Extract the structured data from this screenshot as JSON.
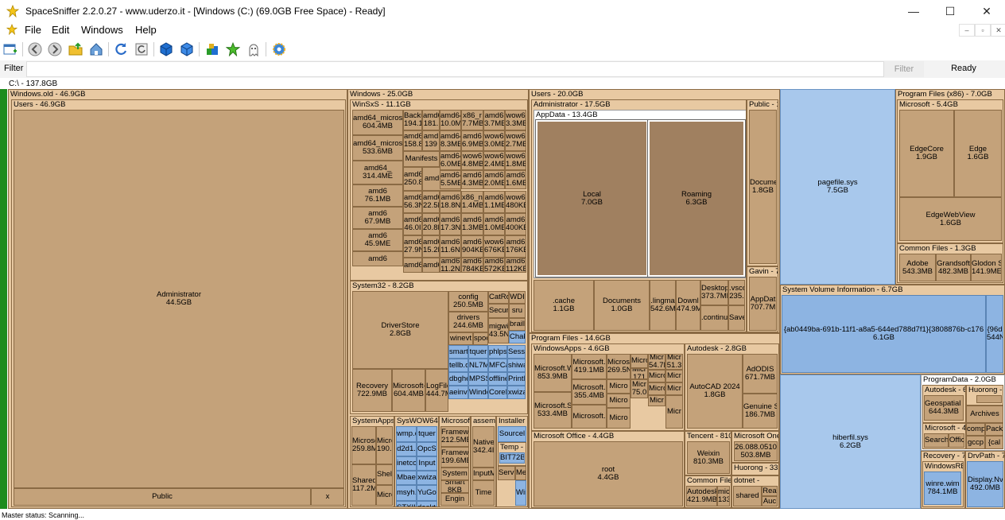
{
  "window": {
    "title": "SpaceSniffer 2.2.0.27 - www.uderzo.it - [Windows (C:) (69.0GB Free Space) - Ready]",
    "minimize": "—",
    "maximize": "☐",
    "close": "✕"
  },
  "menu": {
    "items": [
      "File",
      "Edit",
      "Windows",
      "Help"
    ],
    "mdi": [
      "–",
      "▫",
      "✕"
    ]
  },
  "toolbar": {
    "icons": [
      "new-window-icon",
      "back-icon",
      "forward-icon",
      "folder-up-icon",
      "home-icon",
      "refresh-icon",
      "rescan-icon",
      "blue-cube-icon",
      "blue-cube-2-icon",
      "tag-icon",
      "star-icon",
      "ghost-icon",
      "settings-gear-icon"
    ]
  },
  "filter": {
    "label": "Filter",
    "value": "",
    "button": "Filter",
    "status": "Ready"
  },
  "breadcrumb": "C:\\ - 137.8GB",
  "status_text": "Master status: Scanning...",
  "treemap": {
    "windows_old": {
      "header": "Windows.old - 46.9GB",
      "users_header": "Users - 46.9GB",
      "administrator": {
        "name": "Administrator",
        "size": "44.5GB"
      },
      "public": {
        "name": "Public"
      },
      "x": {
        "name": "x"
      }
    },
    "windows": {
      "header": "Windows - 25.0GB",
      "winsxs": {
        "header": "WinSxS - 11.1GB",
        "cells": [
          {
            "name": "amd64_micros",
            "size": "604.4MB"
          },
          {
            "name": "amd64_micros",
            "size": "533.6MB"
          },
          {
            "name": "amd64_",
            "size": "314.4ME"
          },
          {
            "name": "amd6",
            "size": "76.1MB"
          },
          {
            "name": "amd6",
            "size": "67.9MB"
          },
          {
            "name": "amd6",
            "size": "45.9ME"
          },
          {
            "name": "amd6",
            "size": ""
          },
          {
            "name": "Backu",
            "size": "194.1"
          },
          {
            "name": "amd6",
            "size": "158.8"
          },
          {
            "name": "Manifests",
            "size": ""
          },
          {
            "name": "amd64_",
            "size": "250.8I"
          },
          {
            "name": "amd64_wi",
            "size": ""
          },
          {
            "name": "amd6",
            "size": "56.3N"
          },
          {
            "name": "amd6",
            "size": "46.0I"
          },
          {
            "name": "amd6",
            "size": "27.9N"
          },
          {
            "name": "amd6",
            "size": ""
          },
          {
            "name": "amd64",
            "size": "22.5M"
          },
          {
            "name": "amd64",
            "size": "20.8M"
          },
          {
            "name": "amd64",
            "size": "15.2M"
          },
          {
            "name": "amd64",
            "size": ""
          },
          {
            "name": "amd6",
            "size": "181."
          },
          {
            "name": "amd",
            "size": "139"
          },
          {
            "name": "amd6",
            "size": "18.8N"
          },
          {
            "name": "amd6",
            "size": "17.3N"
          },
          {
            "name": "amd6",
            "size": "11.6N"
          },
          {
            "name": "amd6",
            "size": "11.2N"
          },
          {
            "name": "amd64",
            "size": "10.0M"
          },
          {
            "name": "amd64",
            "size": "8.3MB"
          },
          {
            "name": "amd64",
            "size": "6.0MB"
          },
          {
            "name": "amd64",
            "size": "5.5MB"
          },
          {
            "name": "x86_n",
            "size": "1.4MB"
          },
          {
            "name": "amd6",
            "size": "1.3MB"
          },
          {
            "name": "amd6",
            "size": "904KB"
          },
          {
            "name": "amd6",
            "size": "784KB"
          },
          {
            "name": "x86_r",
            "size": "7.7MB"
          },
          {
            "name": "amd6",
            "size": "6.9MB"
          },
          {
            "name": "wow6",
            "size": "4.8MB"
          },
          {
            "name": "amd6",
            "size": "4.3MB"
          },
          {
            "name": "amd6",
            "size": "1.1MB"
          },
          {
            "name": "amd6",
            "size": "1.0MB"
          },
          {
            "name": "wow6",
            "size": "676KB"
          },
          {
            "name": "amd6",
            "size": "572KE"
          },
          {
            "name": "amd6",
            "size": "3.7MB"
          },
          {
            "name": "wow6",
            "size": "3.0MB"
          },
          {
            "name": "wow6",
            "size": "2.4MB"
          },
          {
            "name": "amd6",
            "size": "2.0MB"
          },
          {
            "name": "wow6",
            "size": "480KE"
          },
          {
            "name": "amd6",
            "size": "400KE"
          },
          {
            "name": "amd6",
            "size": "176KE"
          },
          {
            "name": "amd6",
            "size": "112KE"
          },
          {
            "name": "wow6",
            "size": "3.3MB"
          },
          {
            "name": "wow6",
            "size": "2.7MB"
          },
          {
            "name": "wow6",
            "size": "1.8MB"
          },
          {
            "name": "amd6",
            "size": "1.6MB"
          },
          {
            "name": "wow6",
            "size": "320KE"
          },
          {
            "name": "amd6",
            "size": "244KE"
          },
          {
            "name": "amd6",
            "size": "60KB"
          },
          {
            "name": "x86_v",
            "size": "4KB"
          }
        ]
      },
      "system32": {
        "header": "System32 - 8.2GB",
        "driverstore": {
          "name": "DriverStore",
          "size": "2.8GB"
        },
        "recovery": {
          "name": "Recovery",
          "size": "722.9MB"
        },
        "microsoft": {
          "name": "Microsoft-",
          "size": "604.4MB"
        },
        "logfiles": {
          "name": "LogFile",
          "size": "444.7M"
        },
        "config": {
          "name": "config",
          "size": "250.5MB"
        },
        "drivers": {
          "name": "drivers",
          "size": "244.6MB"
        },
        "catroot": {
          "name": "CatRo"
        },
        "wdi": {
          "name": "WDI"
        },
        "secur": {
          "name": "Secur"
        },
        "sru": {
          "name": "sru"
        },
        "migwiz": {
          "name": "migwi",
          "size": "43.5N"
        },
        "brailler": {
          "name": "braill"
        },
        "winevt": {
          "name": "winevt"
        },
        "spool": {
          "name": "spoo"
        },
        "chakra": {
          "name": "Chak"
        },
        "smart": {
          "name": "smart"
        },
        "tquer": {
          "name": "tquer"
        },
        "phlps": {
          "name": "phlps"
        },
        "sesse": {
          "name": "SessE"
        },
        "tellib": {
          "name": "tellb.c"
        },
        "nl7m": {
          "name": "NL7M"
        },
        "mfca": {
          "name": "MFCa"
        },
        "shiwa": {
          "name": "shiwa"
        },
        "dbghe": {
          "name": "dbghe"
        },
        "mpss": {
          "name": "MPSS"
        },
        "offline": {
          "name": "offline"
        },
        "printb": {
          "name": "PrintI"
        },
        "aeinv": {
          "name": "aeinv."
        },
        "windo": {
          "name": "Windo"
        },
        "corefx": {
          "name": "CoreF"
        },
        "xwiza": {
          "name": "xwiza"
        }
      },
      "systemapps": {
        "header": "SystemApps",
        "microsoft": {
          "name": "Microso",
          "size": "259.8M"
        },
        "micro2": {
          "name": "Micro",
          "size": "190.2"
        },
        "shared": {
          "name": "Shared",
          "size": "117.2M"
        },
        "shell": {
          "name": "Shell"
        },
        "micro3": {
          "name": "Micro"
        }
      },
      "syswow64": {
        "header": "SysWOW64",
        "cells": [
          "wmp.d",
          "tquer",
          "d2d1.",
          "OpcSe",
          "inetco",
          "Input",
          "Mbae",
          "xwiza",
          "msyh.",
          "YuGot",
          "STXIHi",
          "deskto"
        ]
      },
      "microsoft_net": {
        "header": "Microsoft.",
        "framework1": {
          "name": "Framewo",
          "size": "212.5ME"
        },
        "framework2": {
          "name": "Framewo",
          "size": "199.6ME"
        },
        "system": {
          "name": "System"
        },
        "smart": {
          "name": "Smart",
          "size": "8KB"
        },
        "engin": {
          "name": "Engin"
        }
      },
      "assembly": {
        "header": "assemb",
        "native": {
          "name": "Native",
          "size": "342.4I"
        },
        "input": {
          "name": "InputM"
        },
        "time": {
          "name": "Time"
        }
      },
      "installer": {
        "header": "Installer -",
        "source": {
          "name": "Sourcel"
        },
        "temp": {
          "name": "Temp - 2"
        },
        "bit72": {
          "name": "BIT72B."
        },
        "servic": {
          "name": "Servic"
        },
        "media": {
          "name": "Media"
        },
        "windo": {
          "name": "Windo"
        }
      }
    },
    "users": {
      "header": "Users - 20.0GB",
      "administrator": {
        "header": "Administrator - 17.5GB",
        "appdata": {
          "header": "AppData - 13.4GB",
          "local": {
            "name": "Local",
            "size": "7.0GB"
          },
          "roaming": {
            "name": "Roaming",
            "size": "6.3GB"
          }
        },
        "cache": {
          "name": ".cache",
          "size": "1.1GB"
        },
        "documents": {
          "name": "Documents",
          "size": "1.0GB"
        },
        "lingma": {
          "name": ".lingma",
          "size": "542.6MI"
        },
        "downloads": {
          "name": "Downl",
          "size": "474.9M"
        },
        "desktop": {
          "name": "Desktop",
          "size": "373.7ME"
        },
        "vscode": {
          "name": ".vsco",
          "size": "235."
        },
        "continue": {
          "name": ".continue"
        },
        "save": {
          "name": "Save"
        }
      },
      "public": {
        "header": "Public - 1",
        "documents": {
          "name": "Docume",
          "size": "1.8GB"
        }
      },
      "gavin": {
        "header": "Gavin - 7",
        "appdata": {
          "name": "AppDat",
          "size": "707.7M"
        }
      }
    },
    "program_files": {
      "header": "Program Files - 14.6GB",
      "windowsapps": {
        "header": "WindowsApps - 4.6GB",
        "cells": [
          {
            "name": "Microsoft.Wi",
            "size": "853.9MB"
          },
          {
            "name": "Microsoft.Scr",
            "size": "533.4MB"
          },
          {
            "name": "Microsoft.",
            "size": "419.1MB"
          },
          {
            "name": "Microsoft.",
            "size": "355.4MB"
          },
          {
            "name": "Microsoft.",
            "size": ""
          },
          {
            "name": "Micros",
            "size": "269.5N"
          },
          {
            "name": "Micro",
            "size": ""
          },
          {
            "name": "Micro",
            "size": ""
          },
          {
            "name": "Micro",
            "size": ""
          },
          {
            "name": "Micro",
            "size": ""
          },
          {
            "name": "Micr",
            "size": "171"
          },
          {
            "name": "Micr",
            "size": "75.0"
          },
          {
            "name": "Micr",
            "size": "54.7N"
          },
          {
            "name": "Micro",
            "size": ""
          },
          {
            "name": "Micro",
            "size": ""
          },
          {
            "name": "Micr",
            "size": ""
          },
          {
            "name": "Micr",
            "size": "51.3"
          },
          {
            "name": "Micr",
            "size": ""
          },
          {
            "name": "Micr",
            "size": ""
          },
          {
            "name": "Micr",
            "size": ""
          }
        ]
      },
      "autodesk": {
        "header": "Autodesk - 2.8GB",
        "autocad": {
          "name": "AutoCAD 2024",
          "size": "1.8GB"
        },
        "adodis": {
          "name": "AdODIS",
          "size": "671.7MB"
        },
        "genuine": {
          "name": "Genuine S",
          "size": "186.7MB"
        }
      },
      "microsoft_office": {
        "header": "Microsoft Office - 4.4GB",
        "root": {
          "name": "root",
          "size": "4.4GB"
        }
      },
      "tencent": {
        "header": "Tencent - 810",
        "weixin": {
          "name": "Weixin",
          "size": "810.3MB"
        }
      },
      "microsoft_one": {
        "header": "Microsoft One",
        "ver": {
          "name": "26.088.0510",
          "size": "503.8MB"
        }
      },
      "huorong": {
        "header": "Huorong - 33"
      },
      "common_files": {
        "header": "Common Files",
        "autodesk": {
          "name": "Autodesk",
          "size": "421.9MB"
        },
        "micr": {
          "name": "micr",
          "size": "133"
        }
      },
      "dotnet": {
        "header": "dotnet -",
        "shared": {
          "name": "shared"
        },
        "rea": {
          "name": "Rea"
        },
        "auc": {
          "name": "Auc"
        }
      }
    },
    "pagefile": {
      "name": "pagefile.sys",
      "size": "7.5GB"
    },
    "hiberfil": {
      "name": "hiberfil.sys",
      "size": "6.2GB"
    },
    "program_files_x86": {
      "header": "Program Files (x86) - 7.0GB",
      "microsoft": {
        "header": "Microsoft - 5.4GB",
        "edgecore": {
          "name": "EdgeCore",
          "size": "1.9GB"
        },
        "edge": {
          "name": "Edge",
          "size": "1.6GB"
        },
        "edgewebview": {
          "name": "EdgeWebView",
          "size": "1.6GB"
        }
      },
      "common_files": {
        "header": "Common Files - 1.3GB",
        "adobe": {
          "name": "Adobe",
          "size": "543.3MB"
        },
        "grandsoft": {
          "name": "Grandsoft",
          "size": "482.3MB"
        },
        "glodon": {
          "name": "Glodon S",
          "size": "141.9ME"
        }
      }
    },
    "system_volume_information": {
      "header": "System Volume Information - 6.7GB",
      "guid": {
        "name": "{ab0449ba-691b-11f1-a8a5-644ed788d7f1}{3808876b-c176",
        "size": "6.1GB"
      },
      "guid2": {
        "name": "{96d",
        "size": "544N"
      }
    },
    "programdata": {
      "header": "ProgramData - 2.0GB",
      "autodesk": {
        "header": "Autodesk - 6",
        "geospatial": {
          "name": "Geospatial C",
          "size": "644.3MB"
        }
      },
      "huorong": {
        "header": "Huorong -"
      },
      "archives": {
        "name": "Archives"
      },
      "microsoft": {
        "header": "Microsoft - 4",
        "search": {
          "name": "Search"
        },
        "offic": {
          "name": "Offic"
        }
      },
      "comp": {
        "name": "comp"
      },
      "gccp": {
        "name": "gccp"
      },
      "pack": {
        "name": "Pack"
      },
      "cal": {
        "name": "{cal"
      }
    },
    "recovery": {
      "header": "Recovery - 7",
      "windowsre": {
        "header": "WindowsRE",
        "winre": {
          "name": "winre.wim",
          "size": "784.1MB"
        }
      }
    },
    "drvpath": {
      "header": "DrvPath - 7",
      "display": {
        "name": "Display.Nv",
        "size": "492.0MB"
      }
    }
  }
}
